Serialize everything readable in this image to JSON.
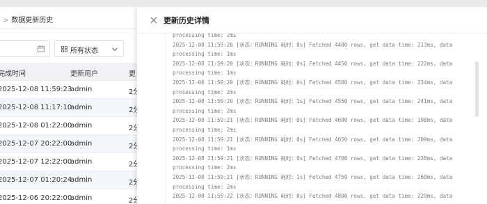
{
  "breadcrumb": {
    "separator": ">",
    "current": "数据更新历史"
  },
  "filters": {
    "status_select": "所有状态"
  },
  "table": {
    "headers": [
      "完成时间",
      "更新用户",
      "更"
    ],
    "rows": [
      [
        "2025-12-08 11:59:23",
        "admin",
        "2分"
      ],
      [
        "2025-12-08 11:17:10",
        "admin",
        "2分"
      ],
      [
        "2025-12-08 01:22:00",
        "admin",
        "2分"
      ],
      [
        "2025-12-07 20:22:00",
        "admin",
        "2分"
      ],
      [
        "2025-12-07 12:22:00",
        "admin",
        "2分"
      ],
      [
        "2025-12-07 01:20:24",
        "admin",
        "2分"
      ],
      [
        "2025-12-06 20:22:00",
        "admin",
        "2分"
      ]
    ]
  },
  "drawer": {
    "title": "更新历史详情",
    "log_lines": [
      "processing time: 2ms",
      "2025-12-08 11:59:20 [状态：RUNNING 耗时：0s] Fetched 4400 rows, get data time: 213ms, data",
      "processing time: 1ms",
      "2025-12-08 11:59:20 [状态：RUNNING 耗时：0s] Fetched 4450 rows, get data time: 222ms, data",
      "processing time: 1ms",
      "2025-12-08 11:59:20 [状态：RUNNING 耗时：0s] Fetched 4500 rows, get data time: 234ms, data",
      "processing time: 2ms",
      "2025-12-08 11:59:20 [状态：RUNNING 耗时：1s] Fetched 4550 rows, get data time: 241ms, data",
      "processing time: 2ms",
      "2025-12-08 11:59:21 [状态：RUNNING 耗时：0s] Fetched 4600 rows, get data time: 198ms, data",
      "processing time: 2ms",
      "2025-12-08 11:59:21 [状态：RUNNING 耗时：0s] Fetched 4650 rows, get data time: 209ms, data",
      "processing time: 1ms",
      "2025-12-08 11:59:21 [状态：RUNNING 耗时：0s] Fetched 4700 rows, get data time: 238ms, data",
      "processing time: 2ms",
      "2025-12-08 11:59:21 [状态：RUNNING 耗时：1s] Fetched 4750 rows, get data time: 260ms, data",
      "processing time: 2ms",
      "2025-12-08 11:59:22 [状态：RUNNING 耗时：0s] Fetched 4800 rows, get data time: 229ms, data"
    ]
  }
}
